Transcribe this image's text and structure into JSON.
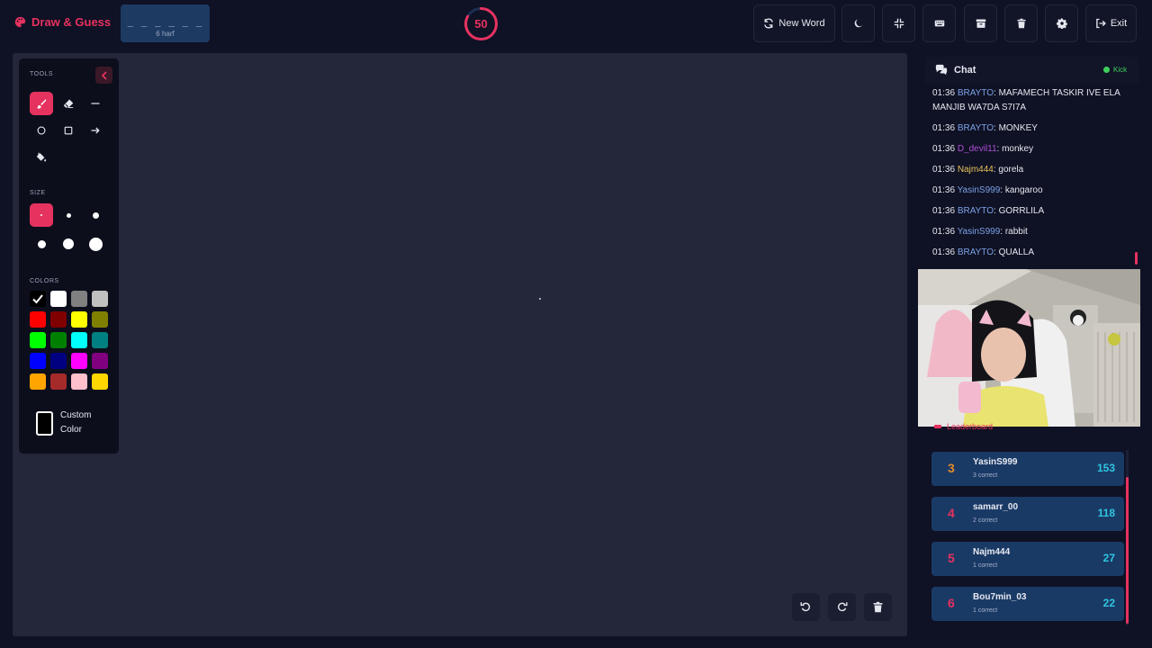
{
  "header": {
    "logo_text": "Draw & Guess",
    "word_blanks": "_ _ _ _ _ _",
    "word_hint": "6 harf",
    "timer_value": "50",
    "timer_fraction": 0.83,
    "new_word_label": "New Word",
    "exit_label": "Exit",
    "icons": [
      "refresh-icon",
      "moon-icon",
      "compress-icon",
      "keyboard-icon",
      "archive-icon",
      "trash-icon",
      "gear-icon",
      "sign-out-icon"
    ]
  },
  "tools": {
    "title": "TOOLS",
    "size_title": "SIZE",
    "colors_title": "COLORS",
    "custom_color_label": "Custom Color",
    "tool_icons": [
      "brush-icon",
      "eraser-icon",
      "line-icon",
      "circle-icon",
      "square-icon",
      "arrow-icon",
      "fill-bucket-icon"
    ],
    "active_tool": "brush",
    "sizes": [
      2,
      5,
      7,
      9,
      12,
      15
    ],
    "active_size": 0,
    "colors": [
      "#000000",
      "#ffffff",
      "#808080",
      "#c0c0c0",
      "#ff0000",
      "#800000",
      "#ffff00",
      "#808000",
      "#00ff00",
      "#008000",
      "#00ffff",
      "#008080",
      "#0000ff",
      "#000080",
      "#ff00ff",
      "#800080",
      "#ffa500",
      "#a52a2a",
      "#ffc0cb",
      "#ffd700"
    ],
    "selected_color": "#000000"
  },
  "canvas_controls": {
    "icons": [
      "undo-icon",
      "redo-icon",
      "trash-icon"
    ]
  },
  "chat": {
    "title": "Chat",
    "platform": "Kick",
    "messages": [
      {
        "time": "01:36",
        "user": "BRAYTO",
        "color": "#7aa2e6",
        "text": "MAFAMECH TASKIR IVE ELA MANJIB WA7DA S7I7A"
      },
      {
        "time": "01:36",
        "user": "BRAYTO",
        "color": "#7aa2e6",
        "text": "MONKEY"
      },
      {
        "time": "01:36",
        "user": "D_devil11",
        "color": "#b04fd8",
        "text": "monkey"
      },
      {
        "time": "01:36",
        "user": "Najm444",
        "color": "#e6c35c",
        "text": "gorela"
      },
      {
        "time": "01:36",
        "user": "YasinS999",
        "color": "#7aa2e6",
        "text": "kangaroo"
      },
      {
        "time": "01:36",
        "user": "BRAYTO",
        "color": "#7aa2e6",
        "text": "GORRLILA"
      },
      {
        "time": "01:36",
        "user": "YasinS999",
        "color": "#7aa2e6",
        "text": "rabbit"
      },
      {
        "time": "01:36",
        "user": "BRAYTO",
        "color": "#7aa2e6",
        "text": "QUALLA"
      }
    ]
  },
  "leaderboard": {
    "title": "Leaderboard",
    "rows": [
      {
        "rank": "3",
        "name": "YasinS999",
        "sub": "3 correct",
        "score": "153",
        "rank_color": "#e08a2a"
      },
      {
        "rank": "4",
        "name": "samarr_00",
        "sub": "2 correct",
        "score": "118",
        "rank_color": "#e6325f"
      },
      {
        "rank": "5",
        "name": "Najm444",
        "sub": "1 correct",
        "score": "27",
        "rank_color": "#e6325f"
      },
      {
        "rank": "6",
        "name": "Bou7min_03",
        "sub": "1 correct",
        "score": "22",
        "rank_color": "#e6325f"
      }
    ]
  },
  "accent_color": "#e6325f"
}
